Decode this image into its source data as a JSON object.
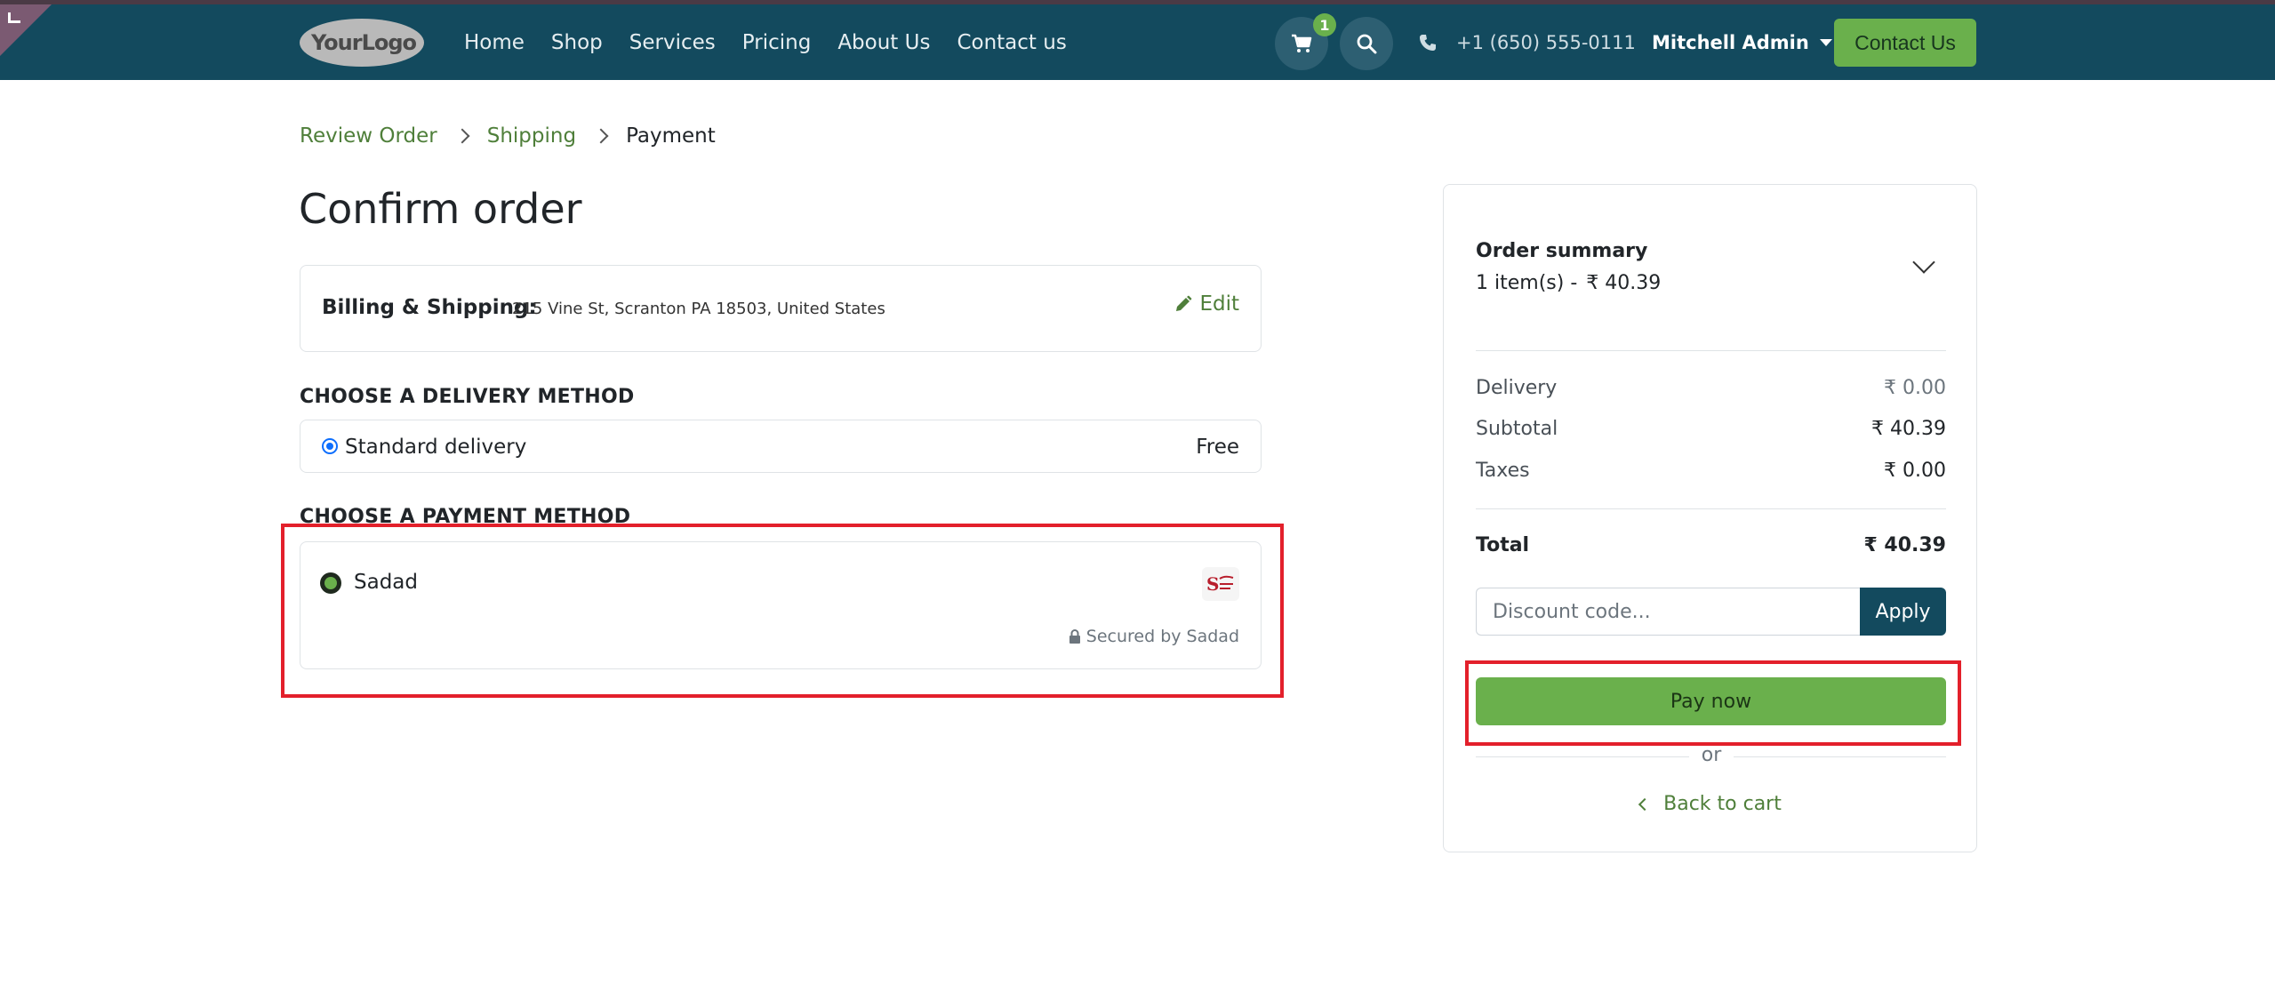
{
  "header": {
    "logo_text": "YourLogo",
    "nav": [
      "Home",
      "Shop",
      "Services",
      "Pricing",
      "About Us",
      "Contact us"
    ],
    "cart_count": "1",
    "phone": "+1 (650) 555-0111",
    "user_name": "Mitchell Admin",
    "contact_button": "Contact Us",
    "colors": {
      "header_bg": "#134a5e",
      "accent": "#6ab04c"
    }
  },
  "breadcrumb": {
    "items": [
      "Review Order",
      "Shipping",
      "Payment"
    ]
  },
  "page_title": "Confirm order",
  "billing": {
    "label": "Billing & Shipping:",
    "address": "215 Vine St, Scranton PA 18503, United States",
    "edit_label": "Edit"
  },
  "delivery": {
    "heading": "CHOOSE A DELIVERY METHOD",
    "method": "Standard delivery",
    "price": "Free"
  },
  "payment": {
    "heading": "CHOOSE A PAYMENT METHOD",
    "method": "Sadad",
    "secured_text": "Secured by Sadad",
    "logo_letter": "S"
  },
  "summary": {
    "title": "Order summary",
    "items_count": "1 item(s) -",
    "items_total": "₹ 40.39",
    "rows": [
      {
        "label": "Delivery",
        "value": "₹ 0.00"
      },
      {
        "label": "Subtotal",
        "value": "₹ 40.39"
      },
      {
        "label": "Taxes",
        "value": "₹ 0.00"
      }
    ],
    "total_label": "Total",
    "total_value": "₹ 40.39",
    "discount_placeholder": "Discount code...",
    "apply_label": "Apply",
    "pay_now_label": "Pay now",
    "or_text": "or",
    "back_label": "Back to cart"
  }
}
